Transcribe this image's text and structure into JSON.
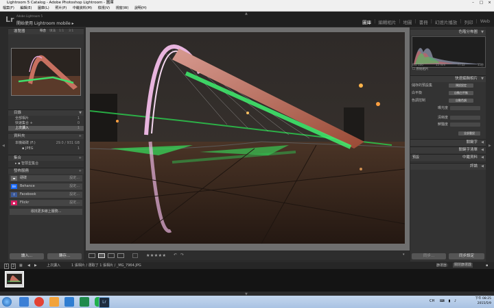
{
  "window": {
    "title": "Lightroom 5 Catalog - Adobe Photoshop Lightroom - 圖庫",
    "controls": [
      "–",
      "□",
      "×"
    ]
  },
  "menu": [
    "檔案(F)",
    "編輯(E)",
    "圖庫(L)",
    "照片(P)",
    "中繼資料(M)",
    "檢視(V)",
    "視窗(W)",
    "說明(H)"
  ],
  "identity": {
    "logo": "Lr",
    "product": "Adobe Lightroom 5",
    "action": "開始使用 Lightroom mobile",
    "action_arrow": "▸"
  },
  "modules": {
    "items": [
      "圖庫",
      "編輯相片",
      "地圖",
      "書冊",
      "幻燈片播放",
      "列印",
      "Web"
    ],
    "active_index": 0
  },
  "left_panel": {
    "navigator": {
      "title": "導覽器",
      "zoom_options": [
        "符合",
        "填滿",
        "1:1",
        "3:1"
      ]
    },
    "catalog": {
      "title": "目錄",
      "rows": [
        {
          "label": "全部相片",
          "count": "1"
        },
        {
          "label": "快速集合 +",
          "count": "0"
        },
        {
          "label": "上次讀入",
          "count": "1"
        }
      ],
      "selected_index": 2
    },
    "folders": {
      "title": "資料夾",
      "volume": "本機磁碟 (F:)",
      "volume_info": "29.0 / 931 GB",
      "folder": "JPEG",
      "folder_count": "1"
    },
    "collections": {
      "title": "集合",
      "items": [
        "智慧型集合"
      ]
    },
    "publish": {
      "title": "發佈服務",
      "services": [
        {
          "name": "硬碟",
          "button": "設定...",
          "icon": "hard-drive-icon",
          "color": "#6a6a6a"
        },
        {
          "name": "Behance",
          "button": "設定...",
          "icon": "behance-icon",
          "color": "#1769ff"
        },
        {
          "name": "Facebook",
          "button": "設定...",
          "icon": "facebook-icon",
          "color": "#3b5998"
        },
        {
          "name": "Flickr",
          "button": "設定...",
          "icon": "flickr-icon",
          "color": "#d81b60"
        }
      ],
      "more": "尋找更多線上服務..."
    },
    "import_label": "讀入...",
    "export_label": "轉存..."
  },
  "toolbar": {
    "stars": "★★★★★",
    "views": [
      "grid-view-icon",
      "loupe-view-icon",
      "compare-view-icon",
      "survey-view-icon"
    ]
  },
  "right_panel": {
    "histogram": {
      "title": "色階分佈圖",
      "iso": "ISO 100",
      "focal": "15 mm",
      "aperture": "f / 22",
      "shutter": "15秒",
      "original_label": "原始相片"
    },
    "quick_develop": {
      "title": "快速編輯相片",
      "rows": [
        {
          "label": "儲存的預設集",
          "value": "預設設定"
        },
        {
          "label": "白平衡",
          "value": "自動白平衡"
        },
        {
          "label": "色調控制",
          "value": "自動色調"
        }
      ],
      "sliders": [
        "曝光度",
        "清晰度",
        "鮮豔度"
      ],
      "reset_all": "全部重設"
    },
    "sections": [
      "關鍵字",
      "關鍵字清單",
      "中繼資料",
      "評論"
    ],
    "metadata_preset": "預設",
    "sync_label": "同步...",
    "reset_label": "同步設定"
  },
  "filmstrip": {
    "pages": [
      "1",
      "2"
    ],
    "source": "上次讀入",
    "info": "1 張相片 / 選取了 1 張相片 / _MG_7964.JPG",
    "filter_label": "篩選器：",
    "filter_value": "關閉篩選器"
  },
  "taskbar": {
    "lang": "CH",
    "time": "下午 08:25",
    "date": "2015/5/9",
    "apps": [
      {
        "name": "ie-icon",
        "color": "#3b7fd6"
      },
      {
        "name": "chrome-icon",
        "color": "#e34234"
      },
      {
        "name": "media-player-icon",
        "color": "#f2a33c"
      },
      {
        "name": "explorer-icon",
        "color": "#2f7dd1"
      },
      {
        "name": "excel-icon",
        "color": "#1f8a4c"
      },
      {
        "name": "line-icon",
        "color": "#20b14c"
      },
      {
        "name": "lightroom-icon",
        "color": "#1c2c3e"
      }
    ]
  }
}
